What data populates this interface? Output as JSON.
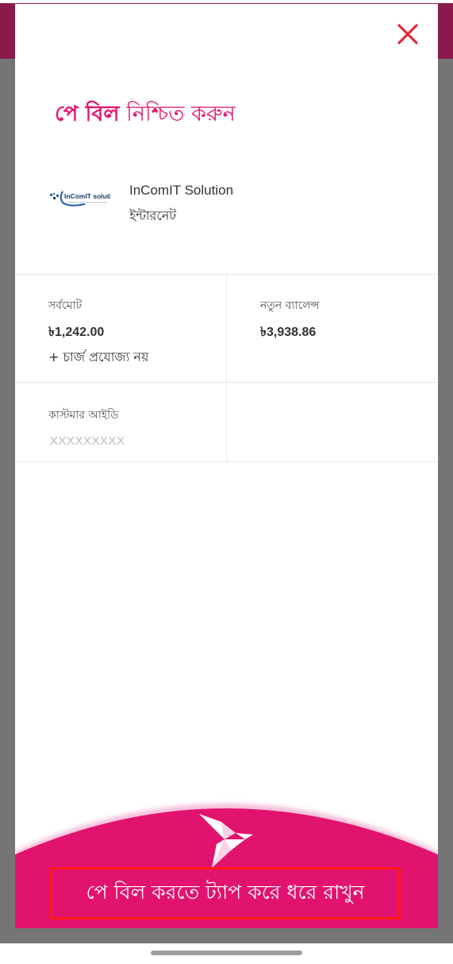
{
  "colors": {
    "accent": "#e2136e",
    "overlay": "#757576",
    "header": "#8a1a4c",
    "highlight": "#ff1a1a"
  },
  "header": {
    "title_bold": "পে বিল",
    "title_rest": "নিশ্চিত করুন",
    "close_icon": "close-icon"
  },
  "merchant": {
    "logo_text": "InComIT solution",
    "name": "InComIT Solution",
    "category": "ইন্টারনেট"
  },
  "details": {
    "total_label": "সর্বমোট",
    "total_value": "৳1,242.00",
    "charge_note": "+ চার্জ প্রযোজ্য নয়",
    "new_balance_label": "নতুন ব্যালেন্স",
    "new_balance_value": "৳3,938.86",
    "customer_id_label": "কাস্টমার আইডি",
    "customer_id_value": "XXXXXXXXX"
  },
  "action": {
    "pay_label": "পে বিল করতে ট্যাপ করে ধরে রাখুন",
    "icon": "bird-logo-icon"
  }
}
